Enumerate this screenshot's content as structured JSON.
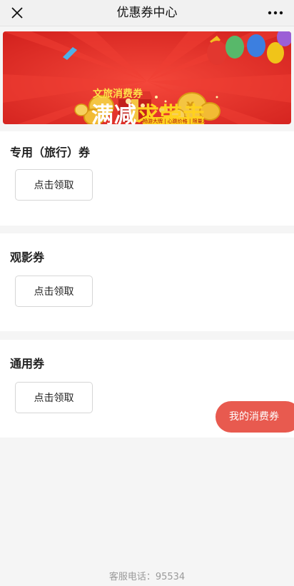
{
  "topbar": {
    "title": "优惠券中心",
    "close_icon": "close-icon",
    "more_icon": "more-icon"
  },
  "banner": {
    "small_text": "文旅消费券",
    "big_text_1": "满减",
    "big_text_2": "求带走",
    "tags": "畅游大牌 | 心跳价格 | 限量发放",
    "colors": {
      "background": "#e0332b",
      "accent": "#ffd11e"
    }
  },
  "sections": [
    {
      "title": "专用（旅行）券",
      "button_label": "点击领取"
    },
    {
      "title": "观影券",
      "button_label": "点击领取"
    },
    {
      "title": "通用券",
      "button_label": "点击领取"
    }
  ],
  "floating": {
    "label": "我的消费券"
  },
  "footer": {
    "service": "客服电话：95534"
  },
  "colors": {
    "primary": "#e85a4f",
    "page_bg": "#f5f5f5"
  }
}
